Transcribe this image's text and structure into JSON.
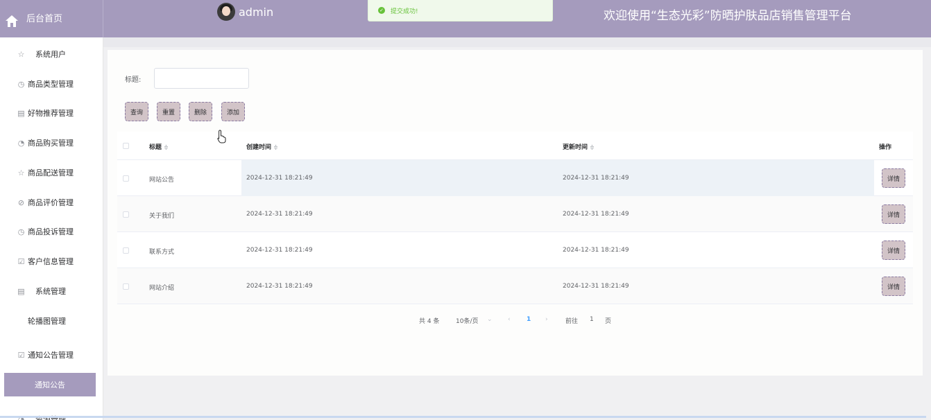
{
  "header": {
    "home_label": "后台首页",
    "username": "admin",
    "toast_message": "提交成功!",
    "platform_title": "欢迎使用“生态光彩”防晒护肤品店销售管理平台",
    "colors": {
      "header_bg": "#a59bbd",
      "toast_green": "#67c23a"
    }
  },
  "sidebar": {
    "items": [
      {
        "label": "系统用户",
        "icon": "star-icon"
      },
      {
        "label": "商品类型管理",
        "icon": "clock-icon"
      },
      {
        "label": "好物推荐管理",
        "icon": "box-icon"
      },
      {
        "label": "商品购买管理",
        "icon": "circle-icon"
      },
      {
        "label": "商品配送管理",
        "icon": "star-icon"
      },
      {
        "label": "商品评价管理",
        "icon": "compass-icon"
      },
      {
        "label": "商品投诉管理",
        "icon": "clock-icon"
      },
      {
        "label": "客户信息管理",
        "icon": "check-square-icon"
      },
      {
        "label": "系统管理",
        "icon": "box-icon"
      },
      {
        "label": "轮播图管理",
        "icon": ""
      },
      {
        "label": "通知公告管理",
        "icon": "check-square-icon"
      },
      {
        "label": "通知公告",
        "icon": "",
        "active": true
      },
      {
        "label": "资源管理",
        "icon": "circle-icon"
      }
    ]
  },
  "search": {
    "title_label": "标题:",
    "title_value": "",
    "buttons": {
      "query": "查询",
      "reset": "重置",
      "delete": "删除",
      "add": "添加"
    }
  },
  "table": {
    "columns": [
      "标题",
      "创建时间",
      "更新时间",
      "操作"
    ],
    "sort_glyph": "≑",
    "detail_label": "详情",
    "rows": [
      {
        "title": "网站公告",
        "created": "2024-12-31 18:21:49",
        "updated": "2024-12-31 18:21:49"
      },
      {
        "title": "关于我们",
        "created": "2024-12-31 18:21:49",
        "updated": "2024-12-31 18:21:49"
      },
      {
        "title": "联系方式",
        "created": "2024-12-31 18:21:49",
        "updated": "2024-12-31 18:21:49"
      },
      {
        "title": "网站介绍",
        "created": "2024-12-31 18:21:49",
        "updated": "2024-12-31 18:21:49"
      }
    ]
  },
  "pagination": {
    "total": "共 4 条",
    "page_size": "10条/页",
    "current_page": "1",
    "goto_prefix": "前往",
    "goto_value": "1",
    "goto_suffix": "页"
  }
}
